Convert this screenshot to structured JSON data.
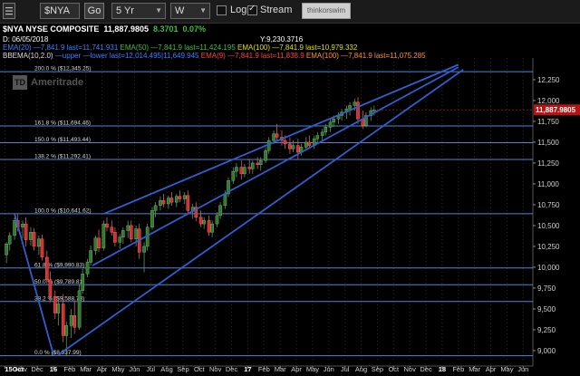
{
  "toolbar": {
    "symbol": "$NYA",
    "go_label": "Go",
    "period": "5 Yr",
    "interval": "W",
    "log_label": "Log",
    "log_checked": false,
    "stream_label": "Stream",
    "stream_checked": true,
    "brand_label": "thinkorswim"
  },
  "header": {
    "symbol": "$NYA",
    "name": "NYSE COMPOSITE",
    "last": "11,887.9805",
    "change": "8.3701",
    "change_pct": "0.07%",
    "date": "D: 06/05/2018",
    "cursor_y": "Y:9,230.3716",
    "ema_line": [
      {
        "text": "EMA(20)",
        "color": "#3f7fff"
      },
      {
        "text": " —7,841.9 last=11,741.931 ",
        "color": "#3f7fff"
      },
      {
        "text": "EMA(50)",
        "color": "#3fbf3f"
      },
      {
        "text": " —7,841.9 last=11,424.195 ",
        "color": "#3fbf3f"
      },
      {
        "text": "EMA(100)",
        "color": "#e0e000"
      },
      {
        "text": " —7,841.9 last=10,979.332",
        "color": "#e0e000"
      }
    ],
    "bb_line": [
      {
        "text": "BBEMA(10,2.0)",
        "color": "#dddddd"
      },
      {
        "text": " —upper —lower last=12,014.495|11,649.945 ",
        "color": "#3f7fff"
      },
      {
        "text": "EMA(9)",
        "color": "#ff4040"
      },
      {
        "text": " —7,841.9 last=11,838.9 ",
        "color": "#ff4040"
      },
      {
        "text": "EMA(100)",
        "color": "#ff9030"
      },
      {
        "text": " —7,841.9 last=11,075.285",
        "color": "#ff9030"
      }
    ],
    "watermark": "Ameritrade"
  },
  "colors": {
    "background": "#000000",
    "up": "#2f7a2f",
    "down": "#d03030",
    "fib_line": "#4e86d6",
    "trend_line": "#2d5fcf",
    "price_badge": "#b51414"
  },
  "chart_data": {
    "type": "candlestick",
    "x_axis_labels": [
      "15Oct",
      "Nov",
      "Dec",
      "16",
      "Feb",
      "Mar",
      "Apr",
      "May",
      "Jun",
      "Jul",
      "Aug",
      "Sep",
      "Oct",
      "Nov",
      "Dec",
      "17",
      "Feb",
      "Mar",
      "Apr",
      "May",
      "Jun",
      "Jul",
      "Aug",
      "Sep",
      "Oct",
      "Nov",
      "Dec",
      "18",
      "Feb",
      "Mar",
      "Apr",
      "May",
      "Jun"
    ],
    "x_label_months": [
      0,
      1,
      2,
      3,
      4,
      5,
      6,
      7,
      8,
      9,
      10,
      11,
      12,
      13,
      14,
      15,
      16,
      17,
      18,
      19,
      20,
      21,
      22,
      23,
      24,
      25,
      26,
      27,
      28,
      29,
      30,
      31,
      32
    ],
    "bold_labels": [
      "15Oct",
      "16",
      "17",
      "18"
    ],
    "y_ticks": [
      9000,
      9250,
      9500,
      9750,
      10000,
      10250,
      10500,
      10750,
      11000,
      11250,
      11500,
      11750,
      12000,
      12250
    ],
    "y_tick_labels": [
      "9,000",
      "9,250",
      "9,500",
      "9,750",
      "10,000",
      "10,250",
      "10,500",
      "10,750",
      "11,000",
      "11,250",
      "11,500",
      "11,750",
      "12,000",
      "12,250"
    ],
    "ylim": [
      8880,
      12510
    ],
    "xlim_months": [
      -0.3,
      32.6
    ],
    "last_price": 11887.9805,
    "last_price_label": "11,887.9805",
    "fib_levels": [
      {
        "label": "200.0 %",
        "value_label": "($12,345.25)",
        "value": 12345.25
      },
      {
        "label": "161.8 %",
        "value_label": "($11,694.46)",
        "value": 11694.46
      },
      {
        "label": "150.0 %",
        "value_label": "($11,493.44)",
        "value": 11493.44
      },
      {
        "label": "138.2 %",
        "value_label": "($11,292.41)",
        "value": 11292.41
      },
      {
        "label": "100.0 %",
        "value_label": "($10,641.62)",
        "value": 10641.62
      },
      {
        "label": "61.8 %",
        "value_label": "($9,990.83)",
        "value": 9990.83
      },
      {
        "label": "50.0 %",
        "value_label": "($9,789.81)",
        "value": 9789.81
      },
      {
        "label": "38.2 %",
        "value_label": "($9,588.78)",
        "value": 9588.78
      },
      {
        "label": "0.0 %",
        "value_label": "($8,937.99)",
        "value": 8937.99
      }
    ],
    "trend_lines": [
      {
        "from": [
          6.1,
          10640
        ],
        "to": [
          28.0,
          12430
        ]
      },
      {
        "from": [
          5.4,
          10020
        ],
        "to": [
          28.0,
          12400
        ]
      },
      {
        "from": [
          3.3,
          8950
        ],
        "to": [
          28.3,
          12370
        ]
      },
      {
        "from": [
          0.6,
          10640
        ],
        "to": [
          3.0,
          8950
        ]
      }
    ],
    "candles": [
      {
        "t": 0.1,
        "o": 10150,
        "h": 10300,
        "l": 10050,
        "c": 10280
      },
      {
        "t": 0.3,
        "o": 10280,
        "h": 10420,
        "l": 10200,
        "c": 10380
      },
      {
        "t": 0.6,
        "o": 10380,
        "h": 10600,
        "l": 10330,
        "c": 10560
      },
      {
        "t": 0.8,
        "o": 10560,
        "h": 10640,
        "l": 10430,
        "c": 10480
      },
      {
        "t": 1.1,
        "o": 10480,
        "h": 10560,
        "l": 10350,
        "c": 10520
      },
      {
        "t": 1.3,
        "o": 10520,
        "h": 10600,
        "l": 10250,
        "c": 10330
      },
      {
        "t": 1.6,
        "o": 10330,
        "h": 10480,
        "l": 10260,
        "c": 10420
      },
      {
        "t": 1.8,
        "o": 10420,
        "h": 10470,
        "l": 10200,
        "c": 10250
      },
      {
        "t": 2.1,
        "o": 10250,
        "h": 10380,
        "l": 10150,
        "c": 10340
      },
      {
        "t": 2.3,
        "o": 10340,
        "h": 10390,
        "l": 10080,
        "c": 10120
      },
      {
        "t": 2.6,
        "o": 10120,
        "h": 10200,
        "l": 9800,
        "c": 9850
      },
      {
        "t": 2.8,
        "o": 9850,
        "h": 9950,
        "l": 9580,
        "c": 9650
      },
      {
        "t": 3.1,
        "o": 9650,
        "h": 9720,
        "l": 9380,
        "c": 9450
      },
      {
        "t": 3.3,
        "o": 9450,
        "h": 9620,
        "l": 9300,
        "c": 9560
      },
      {
        "t": 3.6,
        "o": 9560,
        "h": 9680,
        "l": 9100,
        "c": 9180
      },
      {
        "t": 3.8,
        "o": 9180,
        "h": 9350,
        "l": 8940,
        "c": 9300
      },
      {
        "t": 4.1,
        "o": 9300,
        "h": 9500,
        "l": 9150,
        "c": 9420
      },
      {
        "t": 4.3,
        "o": 9420,
        "h": 9600,
        "l": 9200,
        "c": 9280
      },
      {
        "t": 4.6,
        "o": 9280,
        "h": 9800,
        "l": 9250,
        "c": 9720
      },
      {
        "t": 4.8,
        "o": 9720,
        "h": 9980,
        "l": 9680,
        "c": 9920
      },
      {
        "t": 5.1,
        "o": 9920,
        "h": 10100,
        "l": 9880,
        "c": 10060
      },
      {
        "t": 5.3,
        "o": 10060,
        "h": 10260,
        "l": 10020,
        "c": 10200
      },
      {
        "t": 5.6,
        "o": 10200,
        "h": 10380,
        "l": 10150,
        "c": 10350
      },
      {
        "t": 5.8,
        "o": 10350,
        "h": 10450,
        "l": 10180,
        "c": 10230
      },
      {
        "t": 6.1,
        "o": 10230,
        "h": 10560,
        "l": 10200,
        "c": 10520
      },
      {
        "t": 6.3,
        "o": 10520,
        "h": 10600,
        "l": 10430,
        "c": 10480
      },
      {
        "t": 6.6,
        "o": 10480,
        "h": 10560,
        "l": 10380,
        "c": 10420
      },
      {
        "t": 6.8,
        "o": 10420,
        "h": 10480,
        "l": 10250,
        "c": 10300
      },
      {
        "t": 7.1,
        "o": 10300,
        "h": 10400,
        "l": 10220,
        "c": 10360
      },
      {
        "t": 7.3,
        "o": 10360,
        "h": 10480,
        "l": 10280,
        "c": 10440
      },
      {
        "t": 7.6,
        "o": 10440,
        "h": 10560,
        "l": 10350,
        "c": 10500
      },
      {
        "t": 7.8,
        "o": 10500,
        "h": 10560,
        "l": 10300,
        "c": 10340
      },
      {
        "t": 8.1,
        "o": 10340,
        "h": 10500,
        "l": 10250,
        "c": 10460
      },
      {
        "t": 8.3,
        "o": 10460,
        "h": 10520,
        "l": 10100,
        "c": 10180
      },
      {
        "t": 8.6,
        "o": 10180,
        "h": 10300,
        "l": 9940,
        "c": 10250
      },
      {
        "t": 8.8,
        "o": 10250,
        "h": 10520,
        "l": 10200,
        "c": 10480
      },
      {
        "t": 9.1,
        "o": 10480,
        "h": 10720,
        "l": 10450,
        "c": 10680
      },
      {
        "t": 9.3,
        "o": 10680,
        "h": 10780,
        "l": 10600,
        "c": 10740
      },
      {
        "t": 9.6,
        "o": 10740,
        "h": 10850,
        "l": 10680,
        "c": 10800
      },
      {
        "t": 9.8,
        "o": 10800,
        "h": 10880,
        "l": 10720,
        "c": 10760
      },
      {
        "t": 10.1,
        "o": 10760,
        "h": 10860,
        "l": 10700,
        "c": 10830
      },
      {
        "t": 10.3,
        "o": 10830,
        "h": 10900,
        "l": 10740,
        "c": 10780
      },
      {
        "t": 10.6,
        "o": 10780,
        "h": 10880,
        "l": 10720,
        "c": 10850
      },
      {
        "t": 10.8,
        "o": 10850,
        "h": 10920,
        "l": 10780,
        "c": 10820
      },
      {
        "t": 11.1,
        "o": 10820,
        "h": 10900,
        "l": 10760,
        "c": 10860
      },
      {
        "t": 11.3,
        "o": 10860,
        "h": 10920,
        "l": 10640,
        "c": 10680
      },
      {
        "t": 11.6,
        "o": 10680,
        "h": 10760,
        "l": 10580,
        "c": 10720
      },
      {
        "t": 11.8,
        "o": 10720,
        "h": 10780,
        "l": 10550,
        "c": 10600
      },
      {
        "t": 12.1,
        "o": 10600,
        "h": 10680,
        "l": 10480,
        "c": 10520
      },
      {
        "t": 12.3,
        "o": 10520,
        "h": 10600,
        "l": 10460,
        "c": 10560
      },
      {
        "t": 12.6,
        "o": 10560,
        "h": 10620,
        "l": 10380,
        "c": 10420
      },
      {
        "t": 12.8,
        "o": 10420,
        "h": 10560,
        "l": 10360,
        "c": 10520
      },
      {
        "t": 13.1,
        "o": 10520,
        "h": 10660,
        "l": 10480,
        "c": 10620
      },
      {
        "t": 13.3,
        "o": 10620,
        "h": 10780,
        "l": 10580,
        "c": 10740
      },
      {
        "t": 13.6,
        "o": 10740,
        "h": 10920,
        "l": 10700,
        "c": 10880
      },
      {
        "t": 13.8,
        "o": 10880,
        "h": 11080,
        "l": 10840,
        "c": 11040
      },
      {
        "t": 14.1,
        "o": 11040,
        "h": 11200,
        "l": 11000,
        "c": 11150
      },
      {
        "t": 14.3,
        "o": 11150,
        "h": 11250,
        "l": 11080,
        "c": 11200
      },
      {
        "t": 14.6,
        "o": 11200,
        "h": 11280,
        "l": 11050,
        "c": 11120
      },
      {
        "t": 14.8,
        "o": 11120,
        "h": 11240,
        "l": 11080,
        "c": 11200
      },
      {
        "t": 15.1,
        "o": 11200,
        "h": 11300,
        "l": 11120,
        "c": 11180
      },
      {
        "t": 15.3,
        "o": 11180,
        "h": 11280,
        "l": 11120,
        "c": 11250
      },
      {
        "t": 15.6,
        "o": 11250,
        "h": 11320,
        "l": 11180,
        "c": 11230
      },
      {
        "t": 15.8,
        "o": 11230,
        "h": 11320,
        "l": 11160,
        "c": 11280
      },
      {
        "t": 16.1,
        "o": 11280,
        "h": 11440,
        "l": 11250,
        "c": 11400
      },
      {
        "t": 16.3,
        "o": 11400,
        "h": 11560,
        "l": 11360,
        "c": 11520
      },
      {
        "t": 16.6,
        "o": 11520,
        "h": 11640,
        "l": 11480,
        "c": 11600
      },
      {
        "t": 16.8,
        "o": 11600,
        "h": 11720,
        "l": 11520,
        "c": 11560
      },
      {
        "t": 17.1,
        "o": 11560,
        "h": 11640,
        "l": 11460,
        "c": 11520
      },
      {
        "t": 17.3,
        "o": 11520,
        "h": 11580,
        "l": 11420,
        "c": 11480
      },
      {
        "t": 17.6,
        "o": 11480,
        "h": 11560,
        "l": 11360,
        "c": 11420
      },
      {
        "t": 17.8,
        "o": 11420,
        "h": 11520,
        "l": 11380,
        "c": 11460
      },
      {
        "t": 18.1,
        "o": 11460,
        "h": 11540,
        "l": 11300,
        "c": 11380
      },
      {
        "t": 18.3,
        "o": 11380,
        "h": 11480,
        "l": 11340,
        "c": 11440
      },
      {
        "t": 18.6,
        "o": 11440,
        "h": 11560,
        "l": 11400,
        "c": 11500
      },
      {
        "t": 18.8,
        "o": 11500,
        "h": 11580,
        "l": 11420,
        "c": 11460
      },
      {
        "t": 19.1,
        "o": 11460,
        "h": 11580,
        "l": 11420,
        "c": 11540
      },
      {
        "t": 19.3,
        "o": 11540,
        "h": 11620,
        "l": 11480,
        "c": 11580
      },
      {
        "t": 19.6,
        "o": 11580,
        "h": 11660,
        "l": 11520,
        "c": 11620
      },
      {
        "t": 19.8,
        "o": 11620,
        "h": 11720,
        "l": 11580,
        "c": 11680
      },
      {
        "t": 20.1,
        "o": 11680,
        "h": 11780,
        "l": 11620,
        "c": 11740
      },
      {
        "t": 20.3,
        "o": 11740,
        "h": 11820,
        "l": 11680,
        "c": 11780
      },
      {
        "t": 20.6,
        "o": 11780,
        "h": 11860,
        "l": 11720,
        "c": 11820
      },
      {
        "t": 20.8,
        "o": 11820,
        "h": 11900,
        "l": 11760,
        "c": 11860
      },
      {
        "t": 21.1,
        "o": 11860,
        "h": 11940,
        "l": 11780,
        "c": 11900
      },
      {
        "t": 21.3,
        "o": 11900,
        "h": 11980,
        "l": 11820,
        "c": 11940
      },
      {
        "t": 21.6,
        "o": 11940,
        "h": 12020,
        "l": 11880,
        "c": 11980
      },
      {
        "t": 21.8,
        "o": 11980,
        "h": 12040,
        "l": 11720,
        "c": 11780
      },
      {
        "t": 22.1,
        "o": 11780,
        "h": 11880,
        "l": 11660,
        "c": 11700
      },
      {
        "t": 22.3,
        "o": 11700,
        "h": 11860,
        "l": 11680,
        "c": 11820
      },
      {
        "t": 22.6,
        "o": 11820,
        "h": 11920,
        "l": 11760,
        "c": 11880
      },
      {
        "t": 22.8,
        "o": 11880,
        "h": 11940,
        "l": 11820,
        "c": 11888
      }
    ]
  }
}
